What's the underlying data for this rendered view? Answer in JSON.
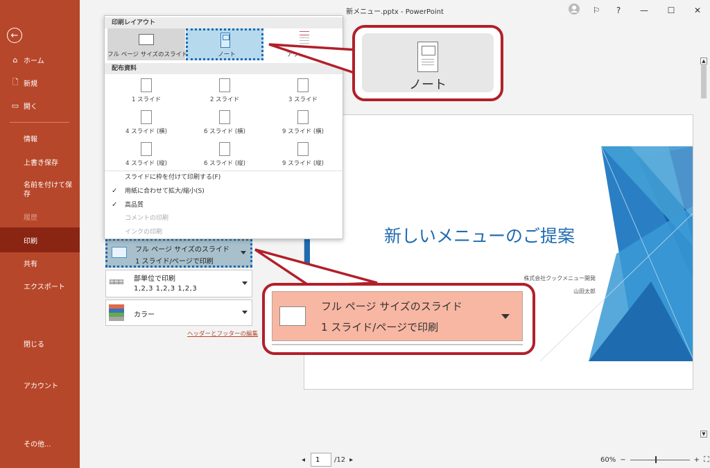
{
  "window": {
    "title": "新メニュー.pptx  -  PowerPoint"
  },
  "sidebar": {
    "back_label": "←",
    "top_items": [
      {
        "label": "ホーム",
        "icon": "home-icon"
      },
      {
        "label": "新規",
        "icon": "new-file-icon"
      },
      {
        "label": "開く",
        "icon": "folder-open-icon"
      }
    ],
    "items": [
      {
        "label": "情報"
      },
      {
        "label": "上書き保存"
      },
      {
        "label": "名前を付けて保存"
      },
      {
        "label": "履歴"
      },
      {
        "label": "印刷"
      },
      {
        "label": "共有"
      },
      {
        "label": "エクスポート"
      },
      {
        "label": "閉じる"
      },
      {
        "label": "アカウント"
      },
      {
        "label": "その他..."
      }
    ]
  },
  "dropdown": {
    "section_print_layout": "印刷レイアウト",
    "layouts": [
      {
        "label": "フル ページ サイズのスライド"
      },
      {
        "label": "ノート"
      },
      {
        "label": "アウトライン"
      }
    ],
    "section_handouts": "配布資料",
    "handouts": [
      "1 スライド",
      "2 スライド",
      "3 スライド",
      "4 スライド (横)",
      "6 スライド (横)",
      "9 スライド (横)",
      "4 スライド (縦)",
      "6 スライド (縦)",
      "9 スライド (縦)"
    ],
    "options": [
      {
        "label": "スライドに枠を付けて印刷する(F)",
        "checked": false,
        "enabled": true
      },
      {
        "label": "用紙に合わせて拡大/縮小(S)",
        "checked": true,
        "enabled": true
      },
      {
        "label": "高品質",
        "checked": true,
        "enabled": true
      },
      {
        "label": "コメントの印刷",
        "checked": false,
        "enabled": false
      },
      {
        "label": "インクの印刷",
        "checked": false,
        "enabled": false
      }
    ]
  },
  "settings": {
    "layout_line1": "フル ページ サイズのスライド",
    "layout_line2": "1 スライド/ページで印刷",
    "collate_line1": "部単位で印刷",
    "collate_line2": "1,2,3    1,2,3    1,2,3",
    "color_label": "カラー",
    "header_footer_link": "ヘッダーとフッターの編集"
  },
  "preview": {
    "title": "新しいメニューのご提案",
    "company": "株式会社クックメニュー開発",
    "author": "山田太郎"
  },
  "pager": {
    "current_page": "1",
    "total": "/12"
  },
  "zoom": {
    "percent": "60%",
    "minus": "−",
    "plus": "+"
  },
  "callouts": {
    "notes_label": "ノート",
    "layout_line1": "フル ページ サイズのスライド",
    "layout_line2": "1 スライド/ページで印刷"
  },
  "colors": {
    "sidebar": "#b7472a",
    "sidebar_active": "#8b2513",
    "accent_blue": "#1f6bb0",
    "callout_red": "#b1202a"
  }
}
